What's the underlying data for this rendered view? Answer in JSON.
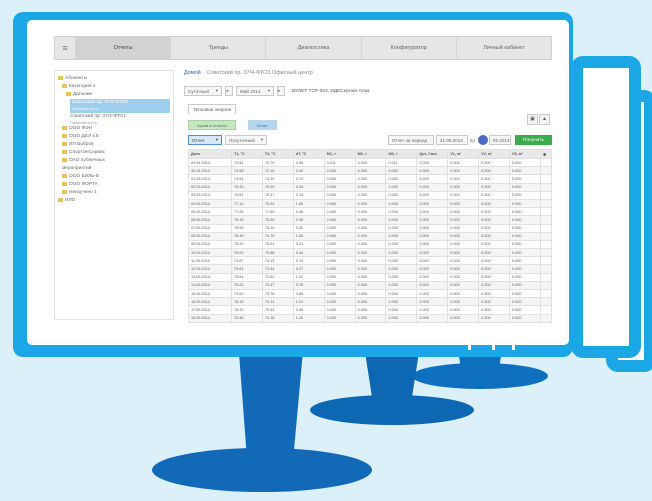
{
  "nav": {
    "tabs": [
      "Отчеты",
      "Тренды",
      "Диагностика",
      "Конфигуратор",
      "Личный кабинет"
    ]
  },
  "tree": [
    {
      "label": "Абоненты"
    },
    {
      "label": "Категория 1"
    },
    {
      "label": "Дальние"
    },
    {
      "label": "Советский пр. 37/4-ФТО3",
      "sub": "Офисный центр",
      "selected": true
    },
    {
      "label": "Советский пр. 37/4-ФТО1",
      "sub": "Офисный центр"
    },
    {
      "label": "ООО ФЭН"
    },
    {
      "label": "ООО ДЕЛ к.5"
    },
    {
      "label": "ИП Бобров"
    },
    {
      "label": "СпортЭнСервис"
    },
    {
      "label": "ОАО публичных"
    },
    {
      "label": "мероприятий"
    },
    {
      "label": "ООО БИЛЬ-Е"
    },
    {
      "label": "ООО ФОРТА"
    },
    {
      "label": "Неизучено 1"
    },
    {
      "label": "ИЛО"
    }
  ],
  "main": {
    "breadcrumb_home": "Домой",
    "breadcrumb": "Советский пр. 37/4-ФТО3 Офисный центр",
    "filter_period": "Суточный",
    "filter_month": "Май 2014",
    "object_title": "ВУЛЕТ ТСР-024, ИДЕСерная Атом",
    "type_tab": "Тепловая энергия",
    "chip_1": "Архив в отчетах",
    "chip_2": "Отчет",
    "select_left": "Отчет",
    "select_right": "Посуточный",
    "date_from_label": "Отчет за период",
    "date_from": "21.05.2014",
    "date_to_label": "по",
    "date_to": "05.2014",
    "build_button": "Получить"
  },
  "table": {
    "columns": [
      "Дата",
      "T1, °C",
      "T2, °C",
      "dT, °C",
      "M1, т",
      "M2, т",
      "M3, т",
      "Qот, Гкал",
      "V1, м³",
      "V2, м³",
      "V3, м³"
    ],
    "rows": [
      [
        "29.04.2014",
        "72.84",
        "72.79",
        "0.05",
        "0.011",
        "0.000",
        "0.011",
        "0.000",
        "0.000",
        "0.000",
        "0.000"
      ],
      [
        "30.04.2014",
        "74.58",
        "72.16",
        "2.42",
        "0.000",
        "0.000",
        "0.000",
        "0.000",
        "0.000",
        "0.000",
        "0.000"
      ],
      [
        "01.05.2014",
        "74.91",
        "74.19",
        "0.72",
        "0.000",
        "0.000",
        "0.000",
        "0.000",
        "0.000",
        "0.000",
        "0.000"
      ],
      [
        "02.05.2014",
        "75.43",
        "75.09",
        "0.34",
        "0.000",
        "0.000",
        "0.000",
        "0.000",
        "0.000",
        "0.000",
        "0.000"
      ],
      [
        "03.05.2014",
        "75.51",
        "75.37",
        "0.14",
        "0.000",
        "0.000",
        "0.000",
        "0.000",
        "0.000",
        "0.000",
        "0.000"
      ],
      [
        "04.05.2014",
        "77.12",
        "75.23",
        "1.89",
        "0.000",
        "0.000",
        "0.000",
        "0.000",
        "0.000",
        "0.000",
        "0.000"
      ],
      [
        "05.05.2014",
        "77.95",
        "77.59",
        "0.36",
        "0.000",
        "0.000",
        "0.000",
        "0.000",
        "0.000",
        "0.000",
        "0.000"
      ],
      [
        "06.05.2014",
        "76.15",
        "75.20",
        "0.95",
        "0.000",
        "0.000",
        "0.000",
        "0.000",
        "0.000",
        "0.000",
        "0.000"
      ],
      [
        "07.05.2014",
        "76.55",
        "76.15",
        "0.40",
        "0.000",
        "0.000",
        "0.000",
        "0.000",
        "0.000",
        "0.000",
        "0.000"
      ],
      [
        "08.05.2014",
        "76.39",
        "74.79",
        "1.60",
        "0.000",
        "0.000",
        "0.000",
        "0.000",
        "0.000",
        "0.000",
        "0.000"
      ],
      [
        "09.05.2014",
        "76.22",
        "76.01",
        "0.21",
        "0.000",
        "0.000",
        "0.000",
        "0.000",
        "0.000",
        "0.000",
        "0.000"
      ],
      [
        "10.05.2014",
        "76.02",
        "75.58",
        "0.44",
        "0.000",
        "0.000",
        "0.000",
        "0.000",
        "0.000",
        "0.000",
        "0.000"
      ],
      [
        "11.05.2014",
        "74.87",
        "74.13",
        "0.74",
        "0.000",
        "0.000",
        "0.000",
        "0.000",
        "0.000",
        "0.000",
        "0.000"
      ],
      [
        "12.05.2014",
        "74.61",
        "74.34",
        "0.27",
        "0.000",
        "0.000",
        "0.000",
        "0.000",
        "0.000",
        "0.000",
        "0.000"
      ],
      [
        "13.05.2014",
        "75.54",
        "74.52",
        "1.02",
        "0.000",
        "0.000",
        "0.000",
        "0.000",
        "0.000",
        "0.000",
        "0.000"
      ],
      [
        "14.05.2014",
        "75.22",
        "74.47",
        "0.75",
        "0.000",
        "0.000",
        "0.000",
        "0.000",
        "0.000",
        "0.000",
        "0.000"
      ],
      [
        "15.05.2014",
        "74.63",
        "73.78",
        "0.85",
        "0.000",
        "0.000",
        "0.000",
        "0.000",
        "0.000",
        "0.000",
        "0.000"
      ],
      [
        "16.05.2014",
        "75.15",
        "74.14",
        "1.01",
        "0.000",
        "0.000",
        "0.000",
        "0.000",
        "0.000",
        "0.000",
        "0.000"
      ],
      [
        "17.05.2014",
        "76.49",
        "75.54",
        "0.95",
        "0.000",
        "0.000",
        "0.000",
        "0.000",
        "0.000",
        "0.000",
        "0.000"
      ],
      [
        "18.05.2014",
        "75.38",
        "74.18",
        "1.20",
        "0.000",
        "0.000",
        "0.000",
        "0.000",
        "0.000",
        "0.000",
        "0.000"
      ]
    ]
  }
}
